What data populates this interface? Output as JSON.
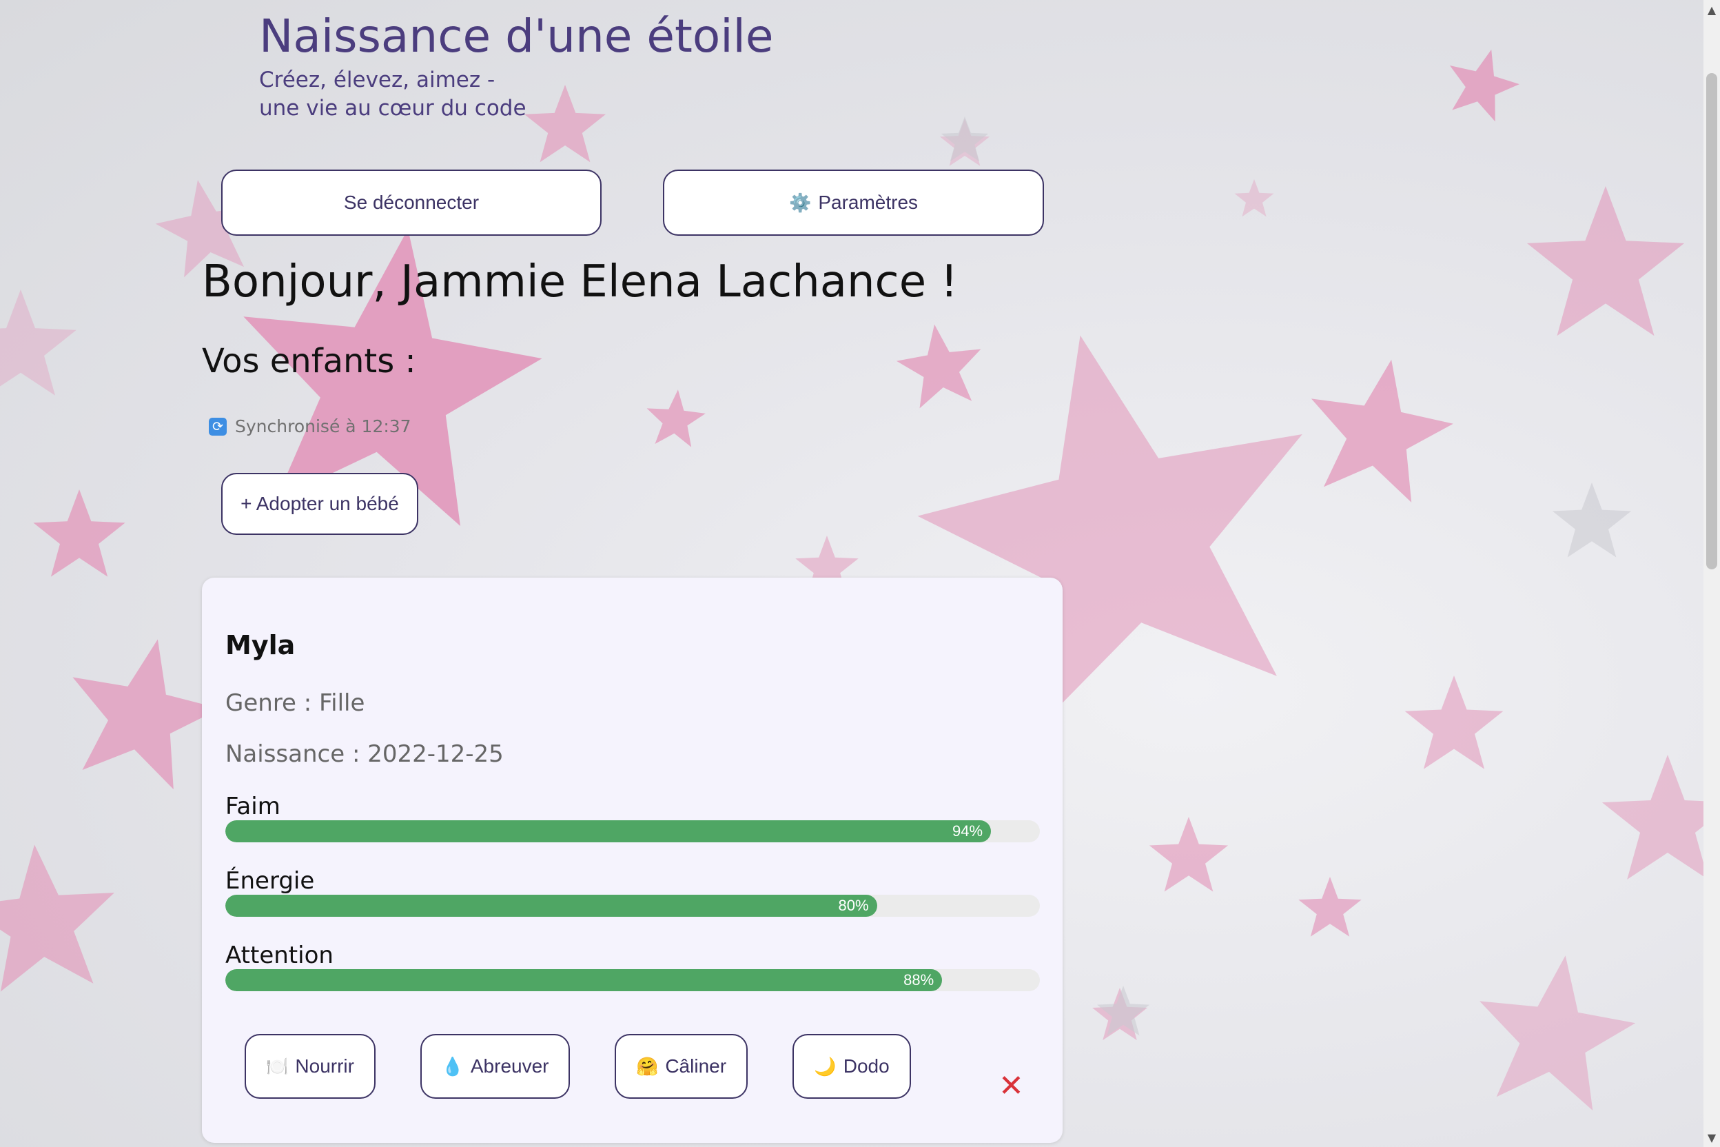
{
  "header": {
    "title": "Naissance d'une étoile",
    "subtitle_line1": "Créez, élevez, aimez -",
    "subtitle_line2": "une vie au cœur du code"
  },
  "nav": {
    "logout_label": "Se déconnecter",
    "settings_label": "Paramètres",
    "settings_icon": "gear-icon"
  },
  "main": {
    "greeting": "Bonjour, Jammie Elena Lachance !",
    "children_heading": "Vos enfants :",
    "sync_status": "Synchronisé à 12:37",
    "sync_icon": "sync-icon",
    "adopt_label": "+ Adopter un bébé"
  },
  "child": {
    "name": "Myla",
    "genre": "Genre : Fille",
    "birth": "Naissance : 2022-12-25",
    "stats": [
      {
        "label": "Faim",
        "value": 94,
        "pct_label": "94%"
      },
      {
        "label": "Énergie",
        "value": 80,
        "pct_label": "80%"
      },
      {
        "label": "Attention",
        "value": 88,
        "pct_label": "88%"
      }
    ],
    "actions": [
      {
        "label": "Nourrir",
        "icon": "plate-icon",
        "glyph": "🍽️"
      },
      {
        "label": "Abreuver",
        "icon": "water-drop-icon",
        "glyph": "💧"
      },
      {
        "label": "Câliner",
        "icon": "hug-icon",
        "glyph": "🤗"
      },
      {
        "label": "Dodo",
        "icon": "moon-icon",
        "glyph": "🌙"
      }
    ],
    "delete_glyph": "✕"
  },
  "colors": {
    "accent": "#4b3d7e",
    "bar_fill": "#4fa664",
    "delete": "#d9323a",
    "star_pink": "#e293b8"
  }
}
